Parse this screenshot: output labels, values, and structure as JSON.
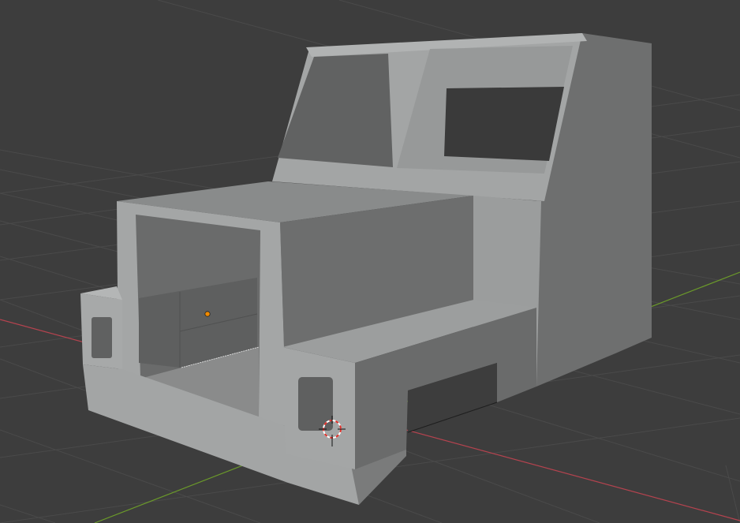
{
  "viewport": {
    "editor": "3D Viewport",
    "view": "perspective",
    "shading": "solid",
    "background_color": "#3d3d3d",
    "grid_color": "#4a4a4a",
    "x_axis_color": "#b5434f",
    "y_axis_color": "#6b9a2a"
  },
  "scene": {
    "object": {
      "icon": "truck-cab-mesh",
      "shading_colors": {
        "light_face": "#9ea0a0",
        "mid_face": "#7f8080",
        "dark_face": "#666767",
        "opening": "#3a3a3a"
      }
    },
    "origin_point": {
      "icon": "object-origin-dot",
      "color": "#f08a00"
    },
    "cursor_3d": {
      "icon": "3d-cursor-icon",
      "colors": [
        "#e0302a",
        "#ffffff"
      ]
    }
  }
}
